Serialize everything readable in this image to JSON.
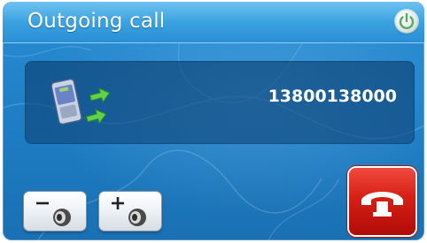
{
  "header": {
    "title": "Outgoing call",
    "power_icon": "power-icon"
  },
  "call": {
    "phone_number": "13800138000",
    "icon": "phone-outgoing-icon"
  },
  "controls": {
    "volume_down_icon": "volume-down-icon",
    "volume_up_icon": "volume-up-icon",
    "hangup_icon": "hang-up-icon"
  },
  "colors": {
    "background": "#1f7fc6",
    "header": "#3ba2e0",
    "panel": "#0c4276",
    "hangup": "#d51f14",
    "text": "#ffffff"
  }
}
